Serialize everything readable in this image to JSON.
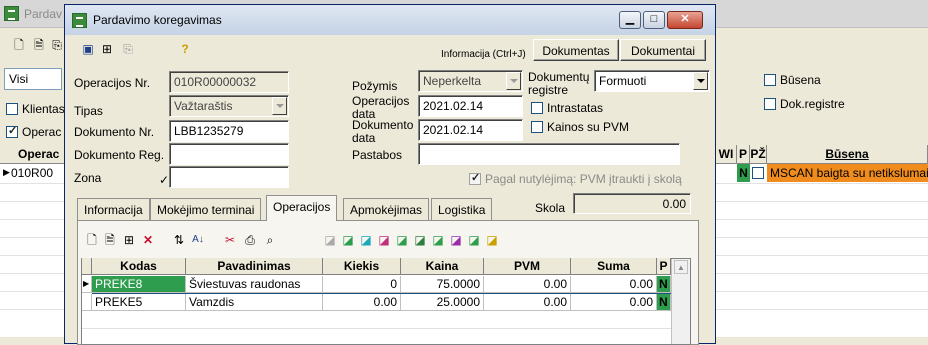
{
  "background_window": {
    "title": "Pardav",
    "filter_value": "Visi",
    "check_klientas": "Klientas",
    "check_operac": "Operac",
    "check_busena": "Būsena",
    "check_dokregistre": "Dok.registre",
    "grid": {
      "col_operac": "Operac",
      "row1": "010R00",
      "col_wi": "WI",
      "col_p": "P",
      "col_pz": "PŽ",
      "col_busena": "Būsena",
      "row1_p": "N",
      "row1_busena": "MSCAN baigta su netikslumais"
    }
  },
  "dialog": {
    "title": "Pardavimo koregavimas",
    "info_hint": "Informacija (Ctrl+J)",
    "btn_dokumentas": "Dokumentas",
    "btn_dokumentai": "Dokumentai",
    "fields": {
      "operacijos_nr_label": "Operacijos Nr.",
      "operacijos_nr_value": "010R00000032",
      "tipas_label": "Tipas",
      "tipas_value": "Važtaraštis",
      "dokumento_nr_label": "Dokumento Nr.",
      "dokumento_nr_value": "LBB1235279",
      "dokumento_reg_label": "Dokumento Reg.",
      "dokumento_reg_value": "",
      "zona_label": "Zona",
      "zona_value": "",
      "pozymis_label": "Požymis",
      "pozymis_value": "Neperkelta",
      "operacijos_data_label_1": "Operacijos",
      "operacijos_data_label_2": "data",
      "operacijos_data_value": "2021.02.14",
      "dokumento_data_label_1": "Dokumento",
      "dokumento_data_label_2": "data",
      "dokumento_data_value": "2021.02.14",
      "pastabos_label": "Pastabos",
      "pastabos_value": "",
      "dok_registre_label_1": "Dokumentų",
      "dok_registre_label_2": "registre",
      "dok_registre_value": "Formuoti",
      "intrastatas_label": "Intrastatas",
      "kainos_su_pvm_label": "Kainos su PVM",
      "pagal_nutylejima_label": "Pagal nutylėjimą: PVM įtraukti į skolą",
      "skola_label": "Skola",
      "skola_value": "0.00"
    },
    "tabs": [
      {
        "label": "Informacija"
      },
      {
        "label": "Mokėjimo terminai"
      },
      {
        "label": "Operacijos"
      },
      {
        "label": "Apmokėjimas"
      },
      {
        "label": "Logistika"
      }
    ],
    "items_grid": {
      "headers": {
        "kodas": "Kodas",
        "pavadinimas": "Pavadinimas",
        "kiekis": "Kiekis",
        "kaina": "Kaina",
        "pvm": "PVM",
        "suma": "Suma",
        "p": "P"
      },
      "rows": [
        {
          "kodas": "PREKE8",
          "pavadinimas": "Šviestuvas raudonas",
          "kiekis": "0",
          "kaina": "75.0000",
          "pvm": "0.00",
          "suma": "0.00",
          "p": "N"
        },
        {
          "kodas": "PREKE5",
          "pavadinimas": "Vamzdis",
          "kiekis": "0.00",
          "kaina": "25.0000",
          "pvm": "0.00",
          "suma": "0.00",
          "p": "N"
        }
      ]
    }
  }
}
